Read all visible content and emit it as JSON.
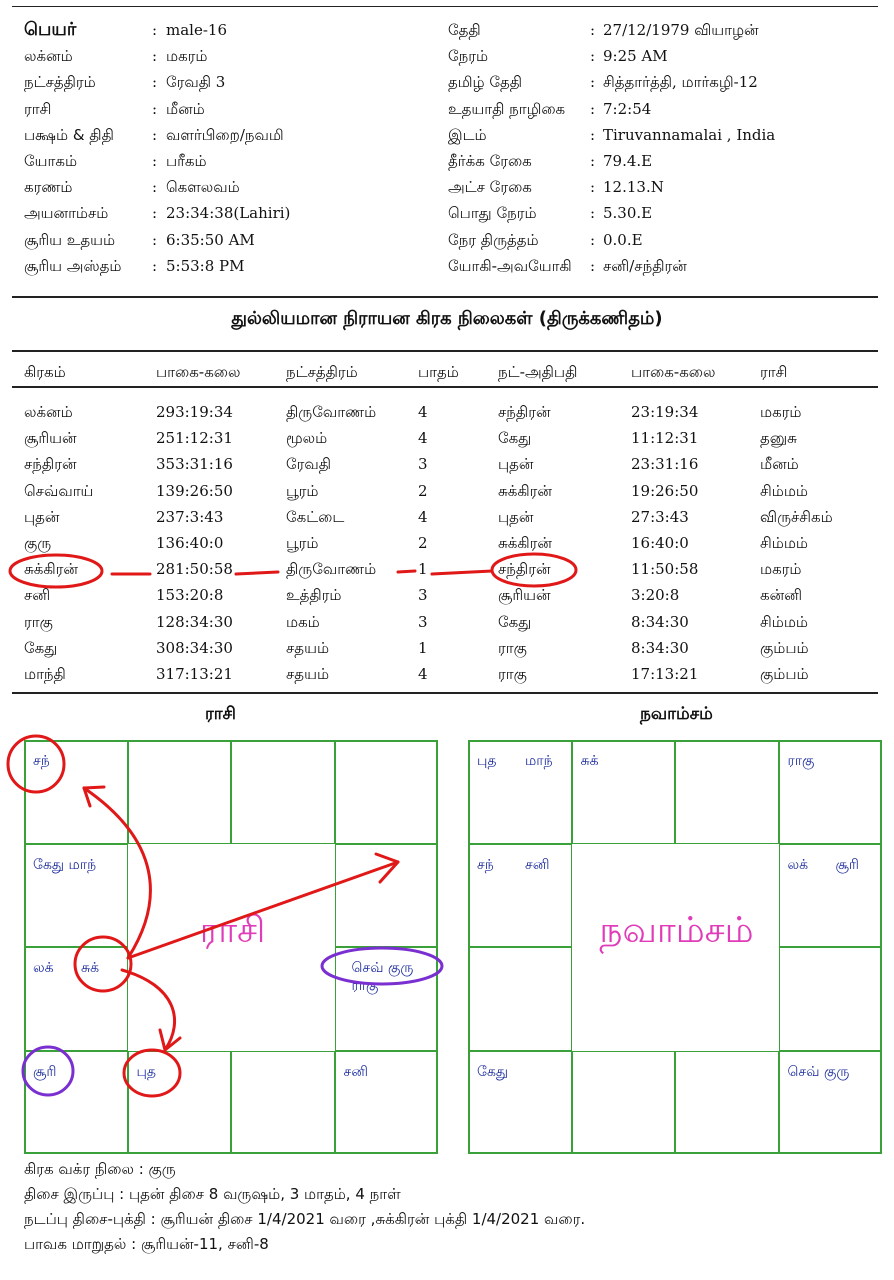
{
  "header": {
    "left": [
      {
        "label": "பெயர்",
        "value": "male-16",
        "bold": true
      },
      {
        "label": "லக்னம்",
        "value": "மகரம்"
      },
      {
        "label": "நட்சத்திரம்",
        "value": "ரேவதி 3"
      },
      {
        "label": "ராசி",
        "value": "மீனம்"
      },
      {
        "label": "பக்ஷம் & திதி",
        "value": "வளர்பிறை/நவமி"
      },
      {
        "label": "யோகம்",
        "value": "பரீகம்"
      },
      {
        "label": "கரணம்",
        "value": "கௌலவம்"
      },
      {
        "label": "அயனாம்சம்",
        "value": "23:34:38(Lahiri)"
      },
      {
        "label": "சூரிய உதயம்",
        "value": "6:35:50 AM"
      },
      {
        "label": "சூரிய அஸ்தம்",
        "value": "5:53:8 PM"
      }
    ],
    "right": [
      {
        "label": "தேதி",
        "value": "27/12/1979 வியாழன்"
      },
      {
        "label": "நேரம்",
        "value": "9:25 AM"
      },
      {
        "label": "தமிழ் தேதி",
        "value": "சித்தார்த்தி, மார்கழி-12"
      },
      {
        "label": "உதயாதி நாழிகை",
        "value": "7:2:54"
      },
      {
        "label": "இடம்",
        "value": "Tiruvannamalai , India"
      },
      {
        "label": "தீர்க்க ரேகை",
        "value": "79.4.E"
      },
      {
        "label": "அட்ச ரேகை",
        "value": "12.13.N"
      },
      {
        "label": "பொது நேரம்",
        "value": "5.30.E"
      },
      {
        "label": "நேர திருத்தம்",
        "value": "0.0.E"
      },
      {
        "label": "யோகி-அவயோகி",
        "value": "சனி/சந்திரன்"
      }
    ],
    "colon": ":"
  },
  "planet_table": {
    "title": "துல்லியமான நிராயன கிரக நிலைகள் (திருக்கணிதம்)",
    "columns": [
      "கிரகம்",
      "பாகை-கலை",
      "நட்சத்திரம்",
      "பாதம்",
      "நட்-அதிபதி",
      "பாகை-கலை",
      "ராசி"
    ],
    "rows": [
      [
        "லக்னம்",
        "293:19:34",
        "திருவோணம்",
        "4",
        "சந்திரன்",
        "23:19:34",
        "மகரம்"
      ],
      [
        "சூரியன்",
        "251:12:31",
        "மூலம்",
        "4",
        "கேது",
        "11:12:31",
        "தனுசு"
      ],
      [
        "சந்திரன்",
        "353:31:16",
        "ரேவதி",
        "3",
        "புதன்",
        "23:31:16",
        "மீனம்"
      ],
      [
        "செவ்வாய்",
        "139:26:50",
        "பூரம்",
        "2",
        "சுக்கிரன்",
        "19:26:50",
        "சிம்மம்"
      ],
      [
        "புதன்",
        "237:3:43",
        "கேட்டை",
        "4",
        "புதன்",
        "27:3:43",
        "விருச்சிகம்"
      ],
      [
        "குரு",
        "136:40:0",
        "பூரம்",
        "2",
        "சுக்கிரன்",
        "16:40:0",
        "சிம்மம்"
      ],
      [
        "சுக்கிரன்",
        "281:50:58",
        "திருவோணம்",
        "1",
        "சந்திரன்",
        "11:50:58",
        "மகரம்"
      ],
      [
        "சனி",
        "153:20:8",
        "உத்திரம்",
        "3",
        "சூரியன்",
        "3:20:8",
        "கன்னி"
      ],
      [
        "ராகு",
        "128:34:30",
        "மகம்",
        "3",
        "கேது",
        "8:34:30",
        "சிம்மம்"
      ],
      [
        "கேது",
        "308:34:30",
        "சதயம்",
        "1",
        "ராகு",
        "8:34:30",
        "கும்பம்"
      ],
      [
        "மாந்தி",
        "317:13:21",
        "சதயம்",
        "4",
        "ராகு",
        "17:13:21",
        "கும்பம்"
      ]
    ]
  },
  "rasi_chart": {
    "title": "ராசி",
    "center_label": "ராசி",
    "cells": {
      "0-0": [
        "சந்"
      ],
      "0-1": [],
      "0-2": [],
      "0-3": [],
      "1-0": [
        "கேது மாந்"
      ],
      "1-3": [],
      "2-0": [
        "லக்",
        "சுக்"
      ],
      "2-3": [
        "செவ் குரு",
        "ராகு"
      ],
      "3-0": [
        "சூரி"
      ],
      "3-1": [
        "புத"
      ],
      "3-2": [],
      "3-3": [
        "சனி"
      ]
    }
  },
  "navamsa_chart": {
    "title": "நவாம்சம்",
    "center_label": "நவாம்சம்",
    "cells": {
      "0-0": [
        "புத",
        "மாந்"
      ],
      "0-1": [
        "சுக்"
      ],
      "0-2": [],
      "0-3": [
        "ராகு"
      ],
      "1-0": [
        "சந்",
        "சனி"
      ],
      "1-3": [
        "லக்",
        "சூரி"
      ],
      "2-0": [],
      "2-3": [],
      "3-0": [
        "கேது"
      ],
      "3-1": [],
      "3-2": [],
      "3-3": [
        "செவ் குரு"
      ]
    }
  },
  "footer": {
    "vakra": "கிரக வக்ர நிலை : குரு",
    "dasa_balance": "திசை இருப்பு : புதன் திசை 8 வருஷம், 3 மாதம், 4 நாள்",
    "current_dasa": "நடப்பு திசை-புக்தி : சூரியன் திசை 1/4/2021 வரை ,சுக்கிரன் புக்தி 1/4/2021 வரை.",
    "bhava": "பாவக மாறுதல் : சூரியன்-11, சனி-8"
  },
  "colors": {
    "grid": "#3aa03a",
    "planet_text": "#1a2a9c",
    "center_text": "#e03bb8",
    "red_annotation": "#e01818",
    "purple_annotation": "#7a2fd0"
  }
}
